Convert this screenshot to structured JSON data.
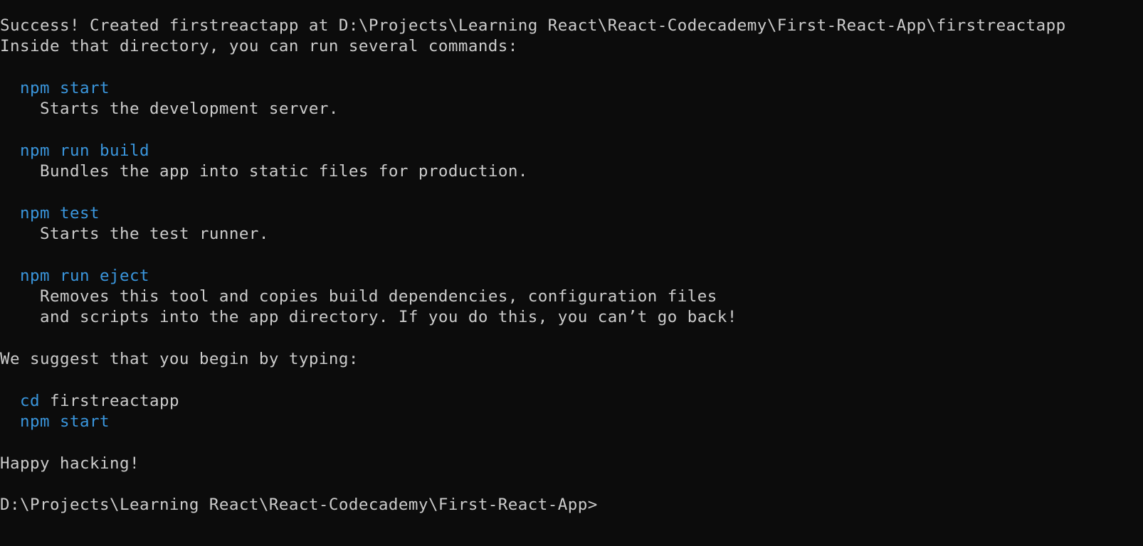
{
  "colors": {
    "background": "#0c0c0c",
    "foreground": "#cccccc",
    "command": "#3a96dd"
  },
  "output": {
    "success_line": "Success! Created firstreactapp at D:\\Projects\\Learning React\\React-Codecademy\\First-React-App\\firstreactapp",
    "inside_line": "Inside that directory, you can run several commands:",
    "commands": [
      {
        "command": "npm start",
        "description": [
          "Starts the development server."
        ]
      },
      {
        "command": "npm run build",
        "description": [
          "Bundles the app into static files for production."
        ]
      },
      {
        "command": "npm test",
        "description": [
          "Starts the test runner."
        ]
      },
      {
        "command": "npm run eject",
        "description": [
          "Removes this tool and copies build dependencies, configuration files",
          "and scripts into the app directory. If you do this, you can’t go back!"
        ]
      }
    ],
    "suggest_line": "We suggest that you begin by typing:",
    "suggested": {
      "cd_keyword": "cd",
      "cd_arg": " firstreactapp",
      "start_command": "npm start"
    },
    "happy_line": "Happy hacking!"
  },
  "prompt": "D:\\Projects\\Learning React\\React-Codecademy\\First-React-App>"
}
